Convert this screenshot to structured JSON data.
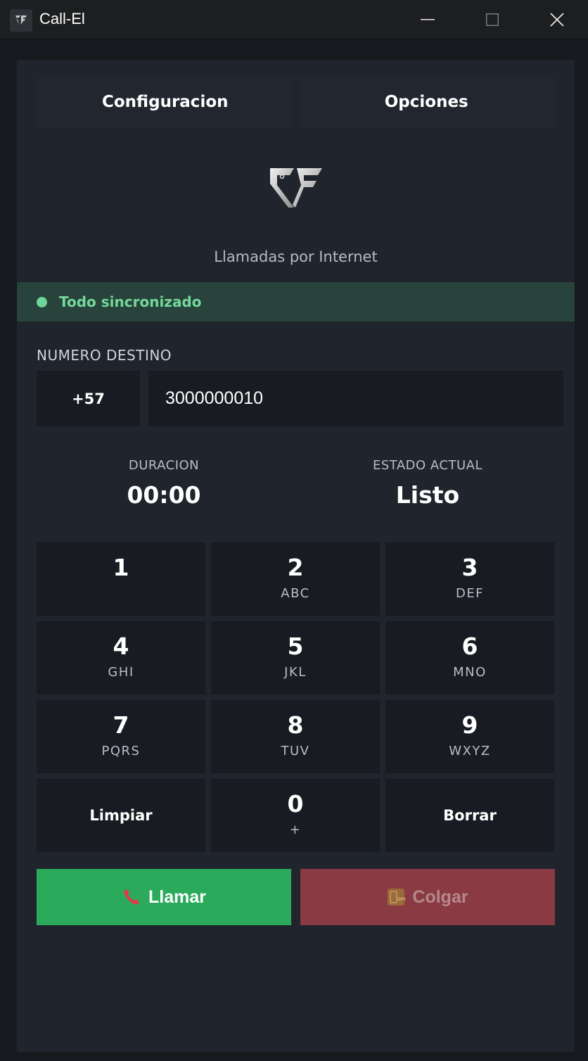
{
  "window": {
    "title": "Call-El",
    "minimize_glyph": "—",
    "close_glyph": "✕"
  },
  "tabs": [
    {
      "label": "Configuracion"
    },
    {
      "label": "Opciones"
    }
  ],
  "brand": {
    "subtitle": "Llamadas por Internet",
    "logo_icon": "ce-logo-icon"
  },
  "status": {
    "text": "Todo sincronizado",
    "color": "#74d89a",
    "background": "#28433c"
  },
  "destination": {
    "label": "NUMERO DESTINO",
    "prefix": "+57",
    "number": "3000000010"
  },
  "call_info": {
    "duration_label": "DURACION",
    "duration_value": "00:00",
    "state_label": "ESTADO ACTUAL",
    "state_value": "Listo"
  },
  "keypad": {
    "keys": [
      {
        "digit": "1",
        "letters": ""
      },
      {
        "digit": "2",
        "letters": "ABC"
      },
      {
        "digit": "3",
        "letters": "DEF"
      },
      {
        "digit": "4",
        "letters": "GHI"
      },
      {
        "digit": "5",
        "letters": "JKL"
      },
      {
        "digit": "6",
        "letters": "MNO"
      },
      {
        "digit": "7",
        "letters": "PQRS"
      },
      {
        "digit": "8",
        "letters": "TUV"
      },
      {
        "digit": "9",
        "letters": "WXYZ"
      },
      {
        "digit": "0",
        "letters": "+"
      }
    ],
    "clear_label": "Limpiar",
    "delete_label": "Borrar"
  },
  "actions": {
    "call_label": "Llamar",
    "call_color": "#2aaa5a",
    "hangup_label": "Colgar",
    "hangup_color": "#8a3a42"
  }
}
